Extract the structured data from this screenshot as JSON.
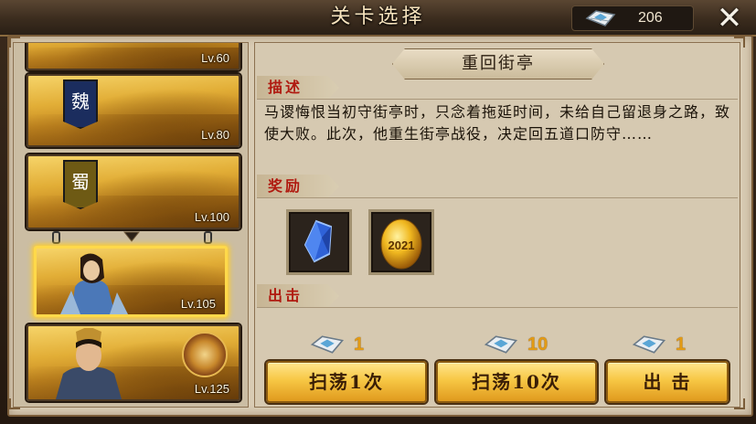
{
  "header": {
    "title": "关卡选择",
    "currency_value": "206",
    "currency_icon": "sweep-ticket-icon",
    "close_icon": "close-icon"
  },
  "stages": [
    {
      "level": "Lv.60",
      "banner": ""
    },
    {
      "level": "Lv.80",
      "banner": "魏"
    },
    {
      "level": "Lv.100",
      "banner": "蜀"
    },
    {
      "level": "Lv.105",
      "banner": "",
      "selected": true
    },
    {
      "level": "Lv.125",
      "banner": ""
    }
  ],
  "detail": {
    "stage_name": "重回街亭",
    "desc_label": "描述",
    "description": "马谡悔恨当初守街亭时，只念着拖延时间，未给自己留退身之路，致使大败。此次，他重生街亭战役，决定回五道口防守……",
    "reward_label": "奖励",
    "rewards": [
      {
        "name": "blue-crystal-icon"
      },
      {
        "name": "golden-egg-icon",
        "text": "2021"
      }
    ],
    "battle_label": "出击"
  },
  "actions": [
    {
      "cost": "1",
      "label": "扫荡1次"
    },
    {
      "cost": "10",
      "label": "扫荡10次"
    },
    {
      "cost": "1",
      "label": "出 击"
    }
  ],
  "colors": {
    "accent_red": "#b01a10",
    "button_gold": "#f7c744",
    "selected_border": "#ffd94a"
  }
}
